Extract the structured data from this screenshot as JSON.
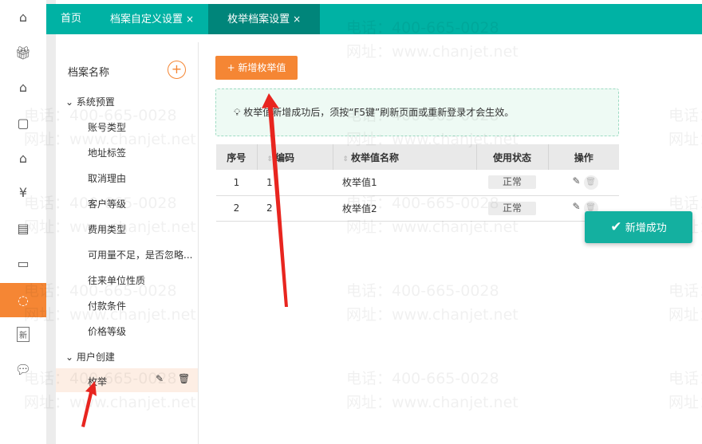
{
  "tabs": [
    {
      "label": "首页",
      "closable": false
    },
    {
      "label": "档案自定义设置",
      "closable": true
    },
    {
      "label": "枚举档案设置",
      "closable": true,
      "active": true
    }
  ],
  "close_glyph": "×",
  "rail": {
    "icons": [
      "home-icon",
      "gift-icon",
      "house-s-icon",
      "bag-icon",
      "building-icon",
      "money-bag-icon",
      "clipboard-icon",
      "id-card-icon",
      "settings-circle-icon",
      "new-icon",
      "chat-icon"
    ],
    "active_index": 8,
    "new_label": "新"
  },
  "panel": {
    "title": "档案名称",
    "add_glyph": "+",
    "groups": [
      {
        "label": "系统预置",
        "items": [
          "账号类型",
          "地址标签",
          "取消理由",
          "客户等级",
          "费用类型",
          "可用量不足，是否忽略...",
          "往来单位性质",
          "付款条件",
          "价格等级"
        ]
      },
      {
        "label": "用户创建",
        "items": [
          "枚举"
        ],
        "selected": "枚举"
      }
    ]
  },
  "main": {
    "add_button": "+ 新增枚举值",
    "tip": "枚举值新增成功后，须按“F5键”刷新页面或重新登录才会生效。",
    "table": {
      "headers": [
        "序号",
        "编码",
        "枚举值名称",
        "使用状态",
        "操作"
      ],
      "rows": [
        {
          "no": "1",
          "code": "1",
          "name": "枚举值1",
          "status": "正常"
        },
        {
          "no": "2",
          "code": "2",
          "name": "枚举值2",
          "status": "正常"
        }
      ]
    }
  },
  "toast": {
    "text": "新增成功",
    "icon": "check-icon"
  },
  "watermark": {
    "phone": "电话：400-665-0028",
    "site": "网址：www.chanjet.net"
  },
  "colors": {
    "teal": "#00b2a4",
    "teal_active": "#00857a",
    "orange": "#f58634",
    "arrow": "#e8251f"
  }
}
